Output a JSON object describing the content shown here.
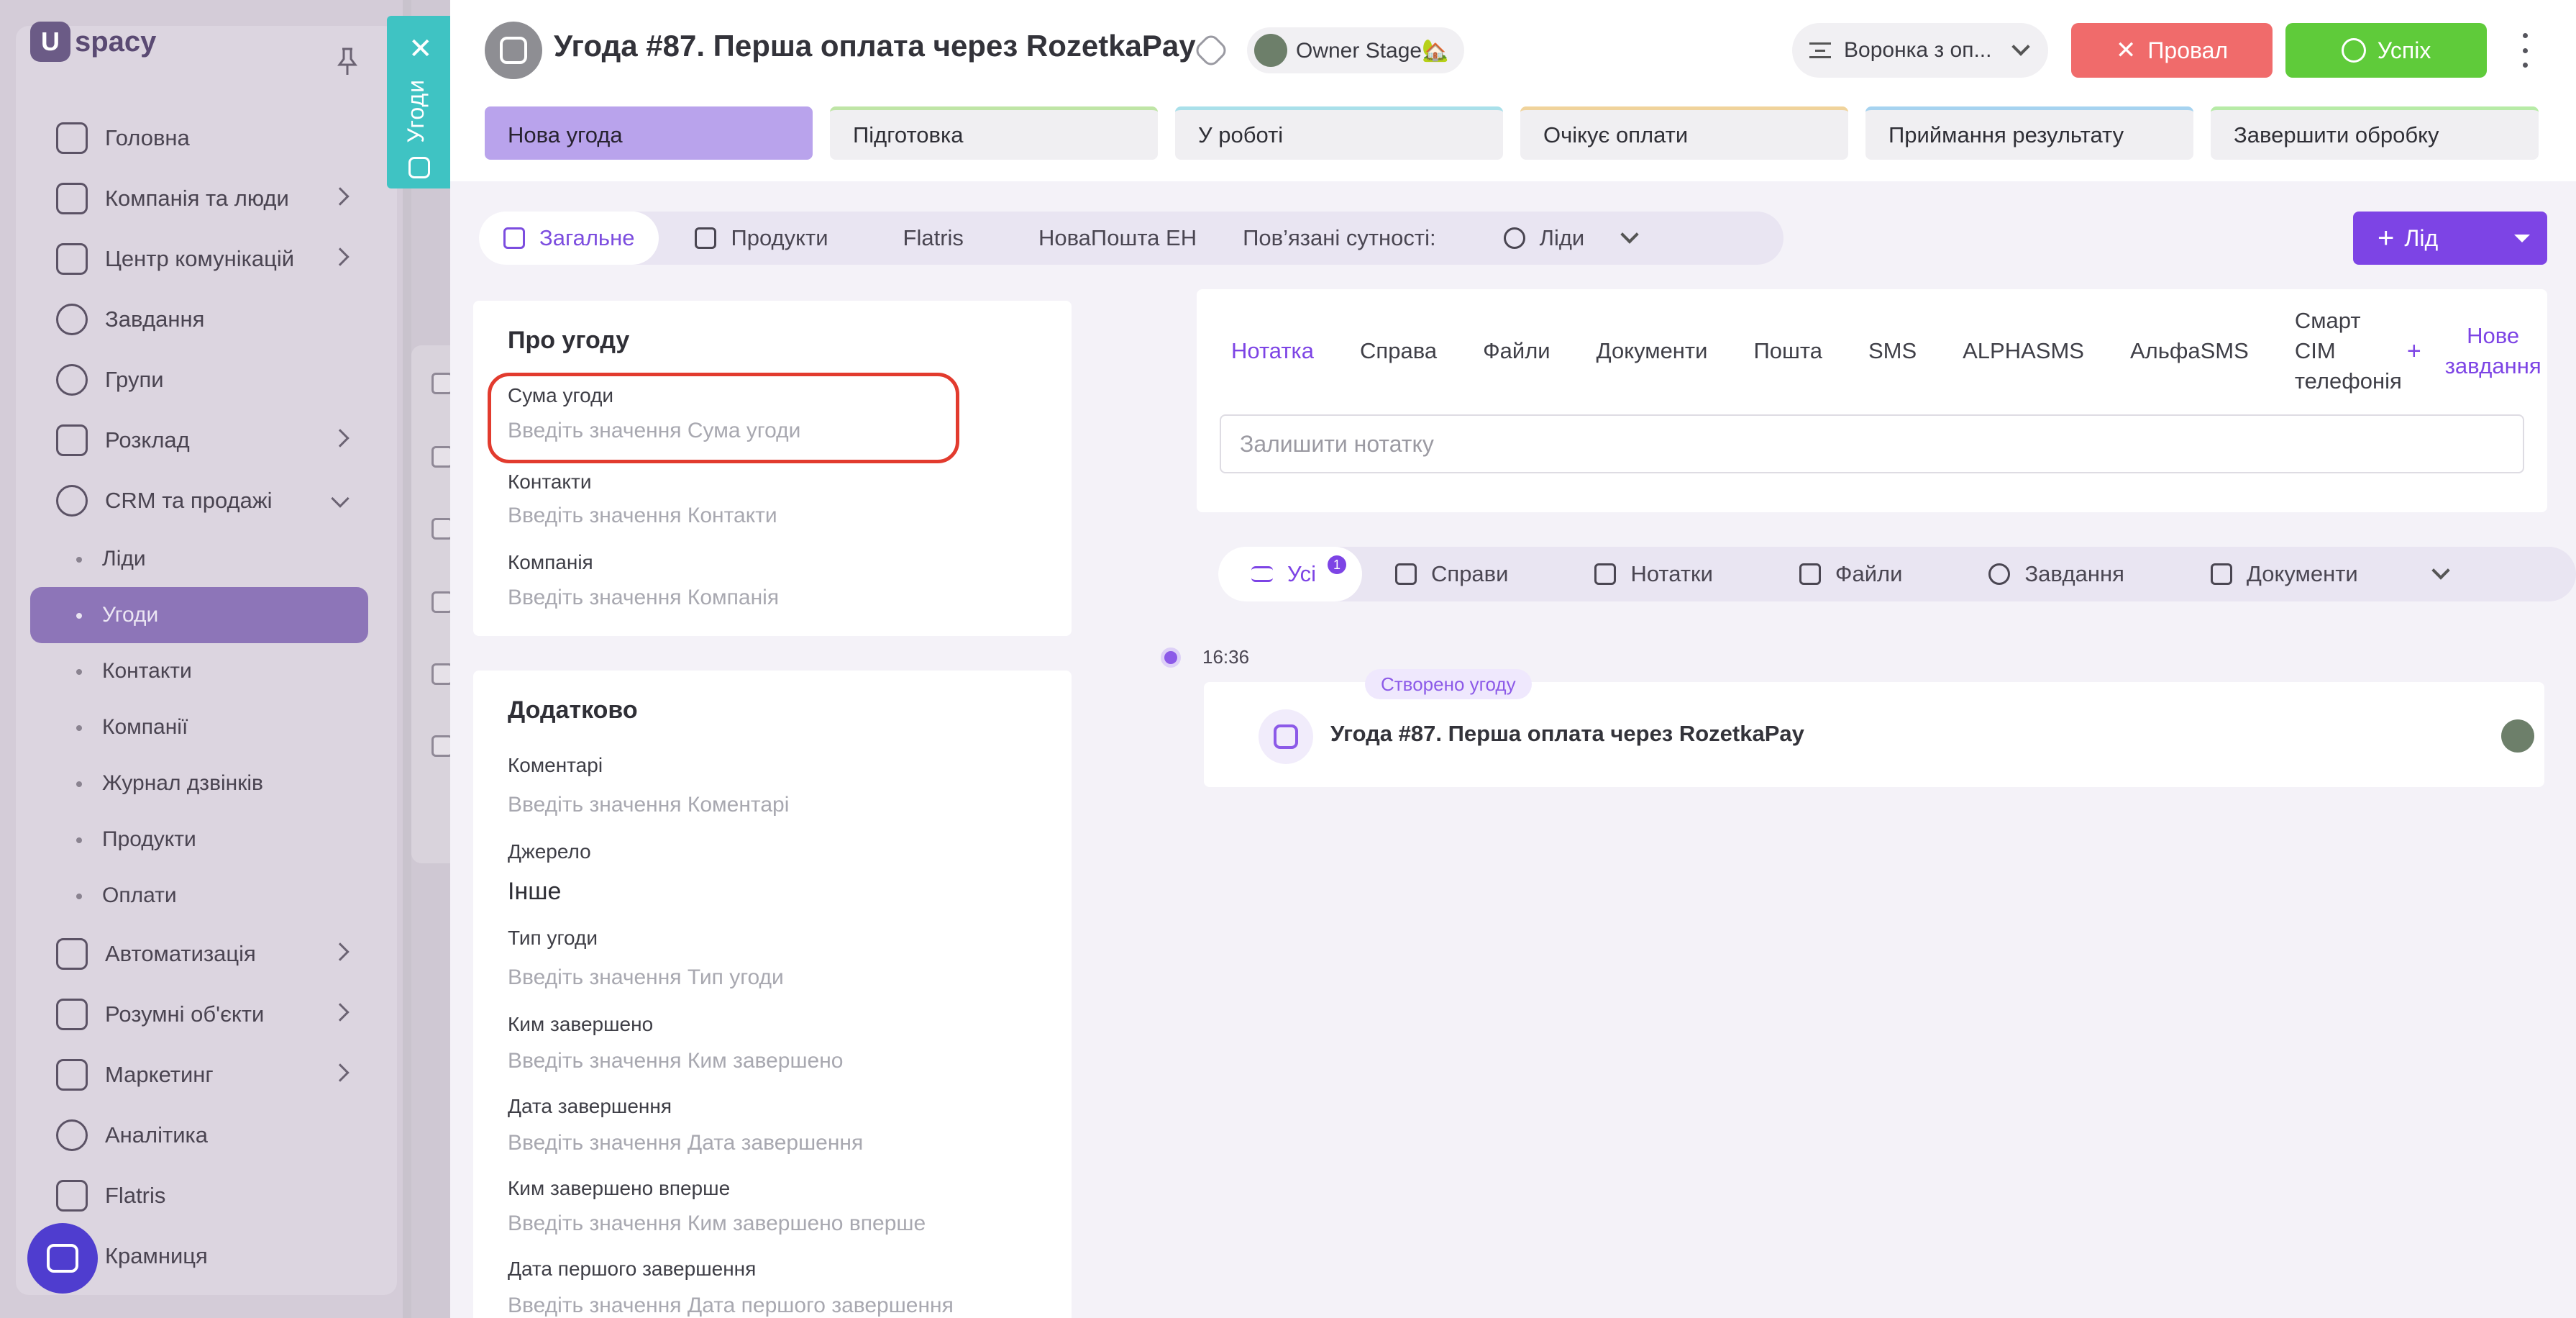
{
  "sidebar": {
    "logo": "spacy",
    "logo_mark": "U",
    "items": [
      {
        "label": "Головна",
        "icon": "home-icon"
      },
      {
        "label": "Компанія та люди",
        "icon": "company-icon"
      },
      {
        "label": "Центр комунікацій",
        "icon": "chat-icon"
      },
      {
        "label": "Завдання",
        "icon": "check-circle-icon"
      },
      {
        "label": "Групи",
        "icon": "users-icon"
      },
      {
        "label": "Розклад",
        "icon": "calendar-icon"
      },
      {
        "label": "CRM та продажі",
        "icon": "database-icon"
      }
    ],
    "crm_sub": [
      "Ліди",
      "Угоди",
      "Контакти",
      "Компанії",
      "Журнал дзвінків",
      "Продукти",
      "Оплати"
    ],
    "items_bottom": [
      {
        "label": "Автоматизація",
        "icon": "bolt-icon"
      },
      {
        "label": "Розумні об'єкти",
        "icon": "smart-object-icon"
      },
      {
        "label": "Маркетинг",
        "icon": "megaphone-icon"
      },
      {
        "label": "Аналітика",
        "icon": "analytics-icon"
      },
      {
        "label": "Flatris",
        "icon": "flatris-icon"
      },
      {
        "label": "Крамниця",
        "icon": "store-icon"
      }
    ]
  },
  "side_tab": {
    "label": "Угоди"
  },
  "header": {
    "title": "Угода #87. Перша оплата через RozetkaPay",
    "owner_stage": "Owner Stage🏡",
    "funnel": "Воронка з оп...",
    "fail_label": "Провал",
    "success_label": "Успіх"
  },
  "stages": [
    "Нова угода",
    "Підготовка",
    "У роботі",
    "Очікує оплати",
    "Приймання результату",
    "Завершити обробку"
  ],
  "tabs": {
    "general": "Загальне",
    "products": "Продукти",
    "flatris": "Flatris",
    "novaposhta": "НоваПошта ЕН",
    "related": "Пов’язані сутності:",
    "leads": "Ліди"
  },
  "lead_button": "Лід",
  "about": {
    "title": "Про угоду",
    "fields": [
      {
        "label": "Сума угоди",
        "value": "Введіть значення Сума угоди"
      },
      {
        "label": "Контакти",
        "value": "Введіть значення Контакти"
      },
      {
        "label": "Компанія",
        "value": "Введіть значення Компанія"
      }
    ]
  },
  "extra": {
    "title": "Додатково",
    "fields": [
      {
        "label": "Коментарі",
        "value": "Введіть значення Коментарі"
      },
      {
        "label": "Джерело",
        "value": "Інше"
      },
      {
        "label": "Тип угоди",
        "value": "Введіть значення Тип угоди"
      },
      {
        "label": "Ким завершено",
        "value": "Введіть значення Ким завершено"
      },
      {
        "label": "Дата завершення",
        "value": "Введіть значення Дата завершення"
      },
      {
        "label": "Ким завершено вперше",
        "value": "Введіть значення Ким завершено вперше"
      },
      {
        "label": "Дата першого завершення",
        "value": "Введіть значення Дата першого завершення"
      }
    ]
  },
  "activity": {
    "tabs": [
      "Нотатка",
      "Справа",
      "Файли",
      "Документи",
      "Пошта",
      "SMS",
      "ALPHASMS",
      "АльфаSMS"
    ],
    "sim_tab": "Смарт СІМ телефонія",
    "new_task": "Нове завдання",
    "note_placeholder": "Залишити нотатку"
  },
  "filters": {
    "all": "Усі",
    "all_count": "1",
    "cases": "Справи",
    "notes": "Нотатки",
    "files": "Файли",
    "tasks": "Завдання",
    "documents": "Документи"
  },
  "timeline": {
    "time": "16:36",
    "tag": "Створено угоду",
    "text": "Угода #87. Перша оплата через RozetkaPay"
  }
}
